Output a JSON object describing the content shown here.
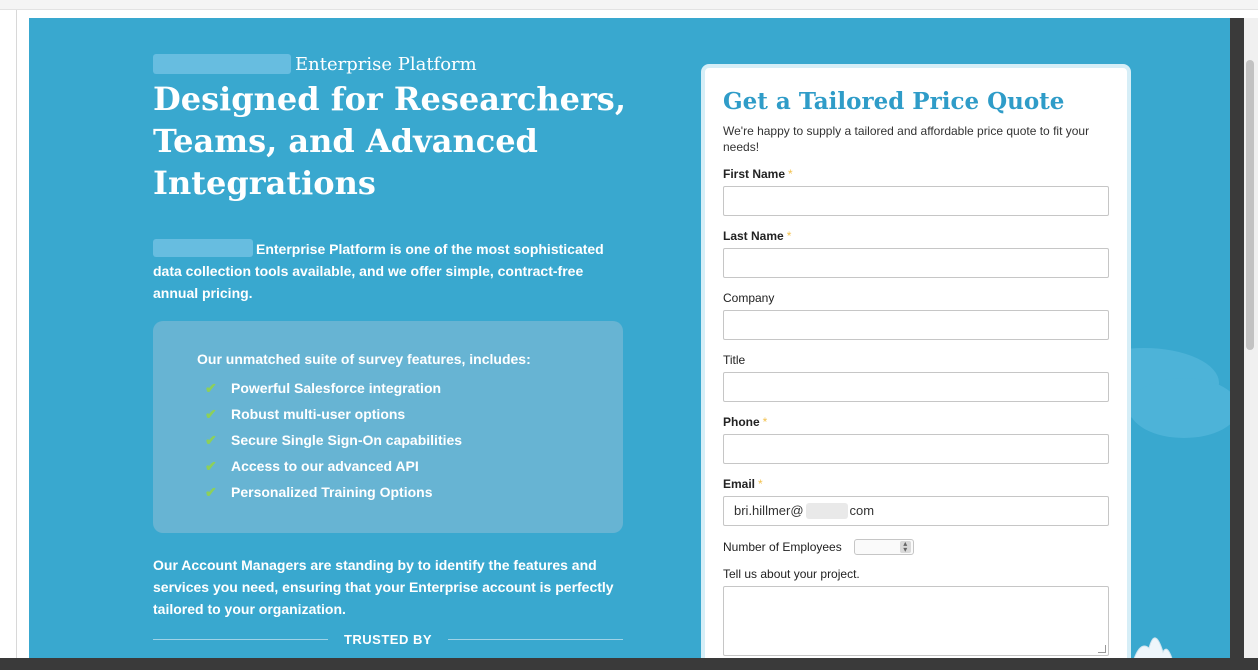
{
  "hero": {
    "brand_suffix": "Enterprise Platform",
    "title": "Designed for Researchers, Teams, and Advanced Integrations",
    "intro": "Enterprise Platform is one of the most sophisticated data collection tools available, and we offer simple, contract-free annual pricing.",
    "features_heading": "Our unmatched suite of survey features, includes:",
    "features": [
      "Powerful Salesforce integration",
      "Robust multi-user options",
      "Secure Single Sign-On capabilities",
      "Access to our advanced API",
      "Personalized Training Options"
    ],
    "account_text": "Our Account Managers are standing by to identify the features and services you need, ensuring that your Enterprise account is perfectly tailored to your organization.",
    "trusted_by": "TRUSTED BY"
  },
  "form": {
    "title": "Get a Tailored Price Quote",
    "subtitle": "We're happy to supply a tailored and affordable price quote to fit your needs!",
    "required_marker": "*",
    "first_name_label": "First Name",
    "last_name_label": "Last Name",
    "company_label": "Company",
    "title_label": "Title",
    "phone_label": "Phone",
    "email_label": "Email",
    "email_value_prefix": "bri.hillmer@",
    "email_value_suffix": "com",
    "employees_label": "Number of Employees",
    "project_label": "Tell us about your project."
  },
  "colors": {
    "background": "#39a8cf",
    "accent": "#2f9cc8",
    "check": "#8dd05a",
    "required_star": "#f2c14e"
  }
}
